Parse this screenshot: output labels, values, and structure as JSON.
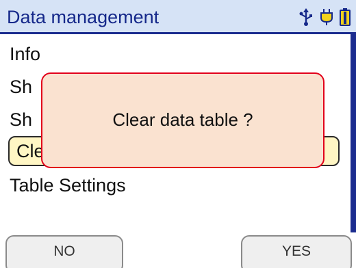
{
  "header": {
    "title": "Data management",
    "icons": [
      "usb-icon",
      "charging-plug-icon",
      "battery-icon"
    ]
  },
  "menu": {
    "items": [
      {
        "label": "Info"
      },
      {
        "label": "Sh"
      },
      {
        "label": "Sh"
      },
      {
        "label": "Cle"
      },
      {
        "label": "Table Settings"
      }
    ],
    "selected_index": 3
  },
  "dialog": {
    "message": "Clear data table ?"
  },
  "softkeys": {
    "left_label": "NO",
    "right_label": "YES"
  },
  "colors": {
    "title_text": "#15288a",
    "titlebar_bg": "#d6e3f6",
    "accent_bar": "#1b2c8f",
    "dialog_bg": "#fae2d0",
    "dialog_border": "#e2001a",
    "selected_bg": "#fff6c4",
    "icon_yellow": "#f2d21c"
  }
}
